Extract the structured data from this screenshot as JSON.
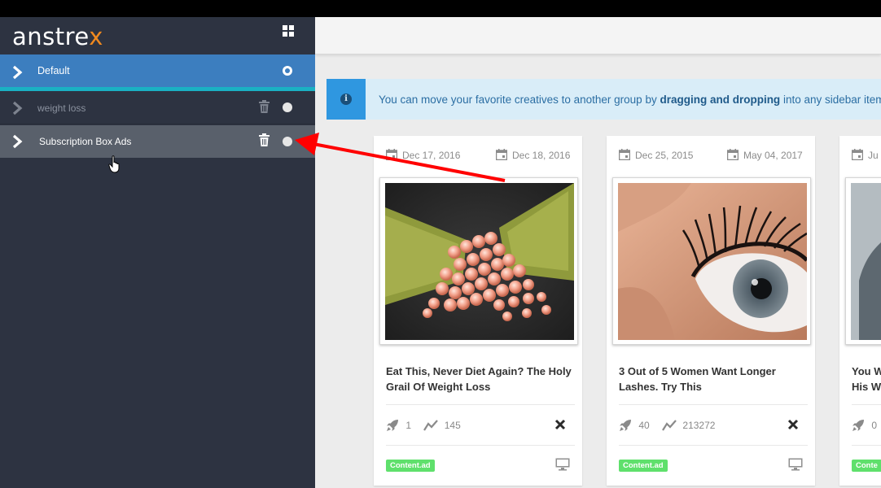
{
  "app": {
    "logo_prefix": "anstre",
    "logo_suffix": "x"
  },
  "sidebar": {
    "groups": [
      {
        "label": "Default",
        "state": "active"
      },
      {
        "label": "weight loss",
        "state": "normal"
      },
      {
        "label": "Subscription Box Ads",
        "state": "hover"
      }
    ]
  },
  "info": {
    "text_before": "You can move your favorite creatives to another group by ",
    "text_bold": "dragging and dropping",
    "text_after": " into any sidebar item."
  },
  "cards": [
    {
      "first_seen": "Dec 17, 2016",
      "last_seen": "Dec 18, 2016",
      "title": "Eat This, Never Diet Again? The Holy Grail Of Weight Loss",
      "rockets": "1",
      "trend": "145",
      "network": "Content.ad"
    },
    {
      "first_seen": "Dec 25, 2015",
      "last_seen": "May 04, 2017",
      "title": "3 Out of 5 Women Want Longer Lashes. Try This",
      "rockets": "40",
      "trend": "213272",
      "network": "Content.ad"
    },
    {
      "first_seen": "Ju",
      "title": "You W His W",
      "rockets": "0",
      "network": "Conte"
    }
  ],
  "colors": {
    "accent_blue": "#3c7ebf",
    "active_underline": "#1ab1c3",
    "badge_green": "#5fe06c",
    "arrow_red": "#ff0000"
  }
}
